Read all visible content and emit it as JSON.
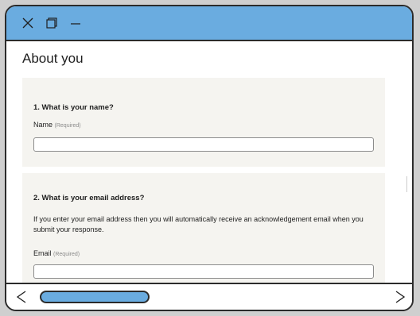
{
  "page": {
    "title": "About you"
  },
  "questions": [
    {
      "heading": "1. What is your name?",
      "field_label": "Name",
      "required_text": "(Required)",
      "value": "",
      "placeholder": ""
    },
    {
      "heading": "2. What is your email address?",
      "help": "If you enter your email address then you will automatically receive an acknowledgement email when you submit your response.",
      "field_label": "Email",
      "required_text": "(Required)",
      "value": "",
      "placeholder": ""
    }
  ],
  "icons": {
    "close": "close-icon",
    "maximize": "maximize-icon",
    "minimize": "minimize-icon",
    "scroll_left": "chevron-left-icon",
    "scroll_right": "chevron-right-icon"
  },
  "colors": {
    "titlebar": "#6aace0",
    "card_bg": "#f5f4f0",
    "border": "#2b2b2b",
    "scroll_thumb": "#6aace0"
  }
}
